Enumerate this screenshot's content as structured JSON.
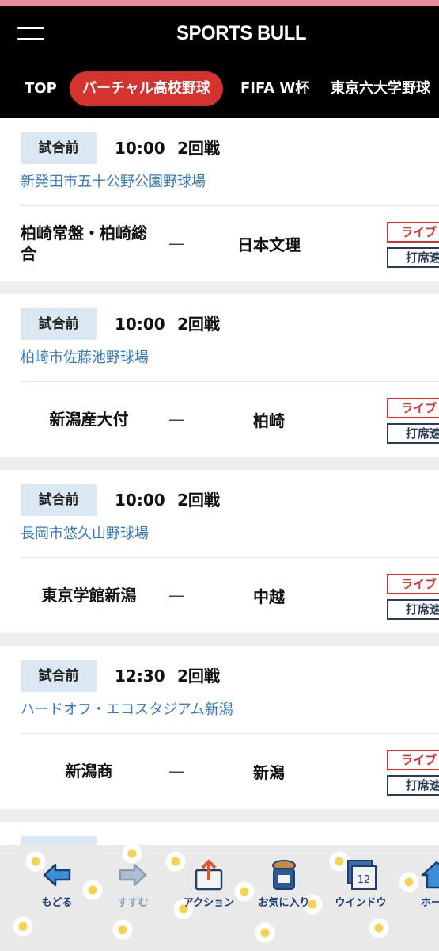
{
  "header": {
    "logo": "SPORTS BULL"
  },
  "nav": {
    "tabs": [
      {
        "label": "TOP"
      },
      {
        "label": "バーチャル高校野球"
      },
      {
        "label": "FIFA W杯"
      },
      {
        "label": "東京六大学野球"
      }
    ],
    "active_index": 1
  },
  "games": [
    {
      "status": "試合前",
      "time": "10:00",
      "round": "2回戦",
      "venue": "新発田市五十公野公園野球場",
      "home": "柏崎常盤・柏崎総合",
      "dash": "—",
      "away": "日本文理",
      "live_label": "ライブ",
      "bat_label": "打席速"
    },
    {
      "status": "試合前",
      "time": "10:00",
      "round": "2回戦",
      "venue": "柏崎市佐藤池野球場",
      "home": "新潟産大付",
      "dash": "—",
      "away": "柏崎",
      "live_label": "ライブ",
      "bat_label": "打席速"
    },
    {
      "status": "試合前",
      "time": "10:00",
      "round": "2回戦",
      "venue": "長岡市悠久山野球場",
      "home": "東京学館新潟",
      "dash": "—",
      "away": "中越",
      "live_label": "ライブ",
      "bat_label": "打席速"
    },
    {
      "status": "試合前",
      "time": "12:30",
      "round": "2回戦",
      "venue": "ハードオフ・エコスタジアム新潟",
      "home": "新潟商",
      "dash": "—",
      "away": "新潟",
      "live_label": "ライブ",
      "bat_label": "打席速"
    }
  ],
  "toolbar": {
    "items": [
      {
        "label": "もどる",
        "icon": "back-arrow-icon"
      },
      {
        "label": "すすむ",
        "icon": "forward-arrow-icon"
      },
      {
        "label": "アクション",
        "icon": "share-icon"
      },
      {
        "label": "お気に入り",
        "icon": "bookmark-jar-icon"
      },
      {
        "label": "ウインドウ",
        "icon": "window-icon",
        "badge": "12"
      },
      {
        "label": "ホー",
        "icon": "home-icon"
      }
    ]
  },
  "colors": {
    "accent": "#d3342f",
    "link": "#3a79b8",
    "status_bg": "#dbe7f2",
    "header_bg": "#000000"
  }
}
